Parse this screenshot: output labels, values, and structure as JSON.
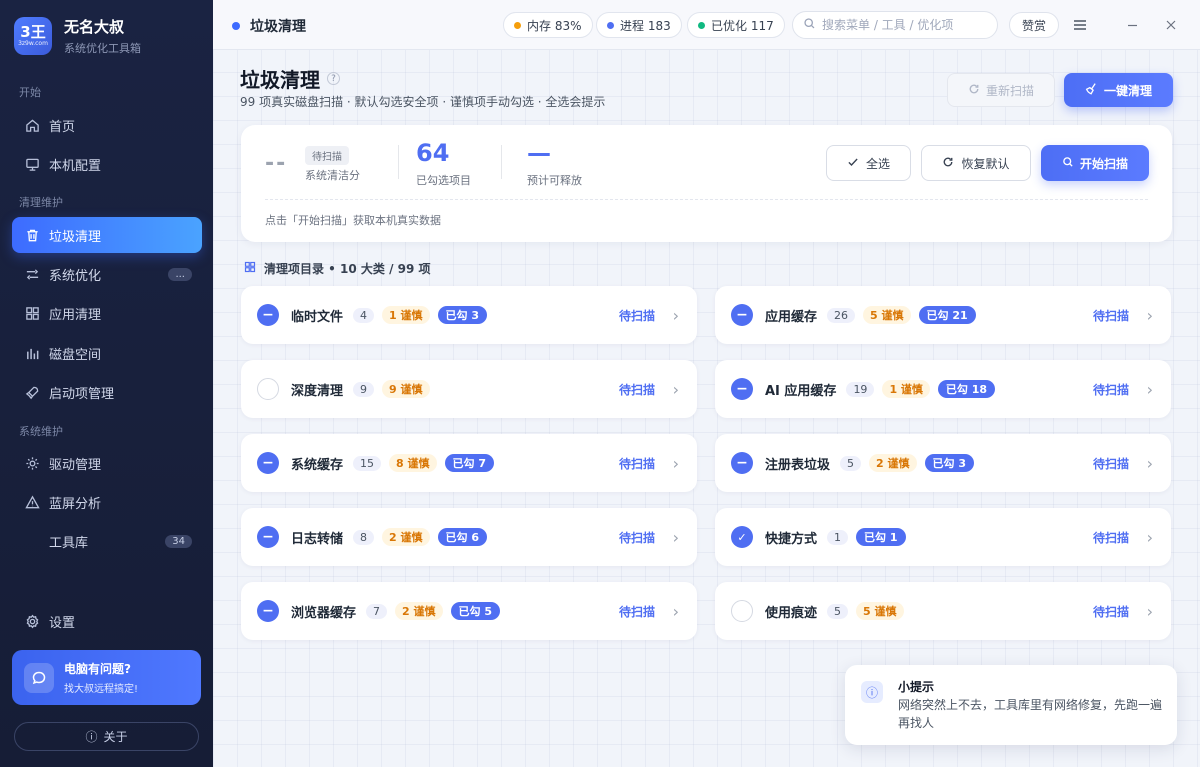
{
  "app": {
    "logo_main": "3王",
    "logo_sub": "3z9w.com",
    "name": "无名大叔",
    "subtitle": "系统优化工具箱"
  },
  "sidebar": {
    "sections": [
      "开始",
      "清理维护",
      "系统维护"
    ],
    "items": [
      {
        "label": "首页",
        "icon": "home-icon"
      },
      {
        "label": "本机配置",
        "icon": "monitor-icon"
      },
      {
        "label": "垃圾清理",
        "icon": "trash-icon",
        "active": true
      },
      {
        "label": "系统优化",
        "icon": "adjust-icon",
        "badge": "..."
      },
      {
        "label": "应用清理",
        "icon": "grid-icon"
      },
      {
        "label": "磁盘空间",
        "icon": "bar-chart-icon"
      },
      {
        "label": "启动项管理",
        "icon": "rocket-icon"
      },
      {
        "label": "驱动管理",
        "icon": "gear-icon"
      },
      {
        "label": "蓝屏分析",
        "icon": "warning-icon"
      },
      {
        "label": "工具库",
        "badge": "34"
      }
    ],
    "settings_label": "设置",
    "help": {
      "title": "电脑有问题?",
      "subtitle": "找大叔远程搞定!"
    },
    "about_label": "关于"
  },
  "topbar": {
    "title": "垃圾清理",
    "memory": "内存 83%",
    "process": "进程 183",
    "optimized": "已优化 117",
    "search_placeholder": "搜索菜单 / 工具 / 优化项",
    "praise": "赞赏",
    "status_colors": {
      "memory": "#f59e0b",
      "process": "#4f6ef2",
      "optimized": "#10b981"
    }
  },
  "page": {
    "title": "垃圾清理",
    "subtitle": "99 项真实磁盘扫描 · 默认勾选安全项 · 谨慎项手动勾选 · 全选会提示",
    "rescan_label": "重新扫描",
    "clean_label": "一键清理"
  },
  "summary": {
    "score": "--",
    "status": "待扫描",
    "score_label": "系统清洁分",
    "checked_count": "64",
    "checked_label": "已勾选项目",
    "release": "—",
    "release_label": "预计可释放",
    "select_all_label": "全选",
    "restore_label": "恢复默认",
    "scan_label": "开始扫描",
    "hint": "点击「开始扫描」获取本机真实数据"
  },
  "section_title": "清理项目录 • 10 大类 / 99 项",
  "categories": [
    {
      "name": "临时文件",
      "count": "4",
      "caution": "1 谨慎",
      "checked": "已勾 3",
      "state": "partial",
      "status": "待扫描"
    },
    {
      "name": "应用缓存",
      "count": "26",
      "caution": "5 谨慎",
      "checked": "已勾 21",
      "state": "partial",
      "status": "待扫描"
    },
    {
      "name": "深度清理",
      "count": "9",
      "caution": "9 谨慎",
      "checked": "",
      "state": "none",
      "status": "待扫描"
    },
    {
      "name": "AI 应用缓存",
      "count": "19",
      "caution": "1 谨慎",
      "checked": "已勾 18",
      "state": "partial",
      "status": "待扫描"
    },
    {
      "name": "系统缓存",
      "count": "15",
      "caution": "8 谨慎",
      "checked": "已勾 7",
      "state": "partial",
      "status": "待扫描"
    },
    {
      "name": "注册表垃圾",
      "count": "5",
      "caution": "2 谨慎",
      "checked": "已勾 3",
      "state": "partial",
      "status": "待扫描"
    },
    {
      "name": "日志转储",
      "count": "8",
      "caution": "2 谨慎",
      "checked": "已勾 6",
      "state": "partial",
      "status": "待扫描"
    },
    {
      "name": "快捷方式",
      "count": "1",
      "caution": "",
      "checked": "已勾 1",
      "state": "full",
      "status": "待扫描"
    },
    {
      "name": "浏览器缓存",
      "count": "7",
      "caution": "2 谨慎",
      "checked": "已勾 5",
      "state": "partial",
      "status": "待扫描"
    },
    {
      "name": "使用痕迹",
      "count": "5",
      "caution": "5 谨慎",
      "checked": "",
      "state": "none",
      "status": "待扫描"
    }
  ],
  "toast": {
    "title": "小提示",
    "body": "网络突然上不去，工具库里有网络修复，先跑一遍再找人"
  }
}
